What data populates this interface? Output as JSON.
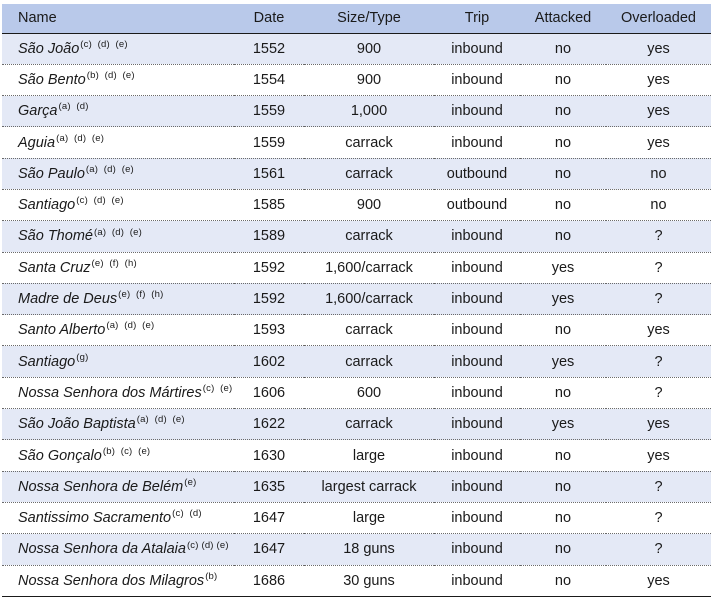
{
  "columns": [
    "Name",
    "Date",
    "Size/Type",
    "Trip",
    "Attacked",
    "Overloaded"
  ],
  "rows": [
    {
      "name": "São João",
      "notes": "(c)  (d)  (e)",
      "date": "1552",
      "size": "900",
      "trip": "inbound",
      "attacked": "no",
      "overloaded": "yes"
    },
    {
      "name": "São Bento",
      "notes": "(b)  (d)  (e)",
      "date": "1554",
      "size": "900",
      "trip": "inbound",
      "attacked": "no",
      "overloaded": "yes"
    },
    {
      "name": "Garça",
      "notes": "(a)  (d)",
      "date": "1559",
      "size": "1,000",
      "trip": "inbound",
      "attacked": "no",
      "overloaded": "yes"
    },
    {
      "name": "Aguia",
      "notes": "(a)  (d)  (e)",
      "date": "1559",
      "size": "carrack",
      "trip": "inbound",
      "attacked": "no",
      "overloaded": "yes"
    },
    {
      "name": "São Paulo",
      "notes": "(a)  (d)  (e)",
      "date": "1561",
      "size": "carrack",
      "trip": "outbound",
      "attacked": "no",
      "overloaded": "no"
    },
    {
      "name": "Santiago",
      "notes": "(c)  (d)  (e)",
      "date": "1585",
      "size": "900",
      "trip": "outbound",
      "attacked": "no",
      "overloaded": "no"
    },
    {
      "name": "São Thomé",
      "notes": "(a)  (d)  (e)",
      "date": "1589",
      "size": "carrack",
      "trip": "inbound",
      "attacked": "no",
      "overloaded": "?"
    },
    {
      "name": "Santa Cruz",
      "notes": "(e)  (f)  (h)",
      "date": "1592",
      "size": "1,600/carrack",
      "trip": "inbound",
      "attacked": "yes",
      "overloaded": "?"
    },
    {
      "name": "Madre de Deus",
      "notes": "(e)  (f)  (h)",
      "date": "1592",
      "size": "1,600/carrack",
      "trip": "inbound",
      "attacked": "yes",
      "overloaded": "?"
    },
    {
      "name": "Santo Alberto",
      "notes": "(a)  (d)  (e)",
      "date": "1593",
      "size": "carrack",
      "trip": "inbound",
      "attacked": "no",
      "overloaded": "yes"
    },
    {
      "name": "Santiago",
      "notes": "(g)",
      "date": "1602",
      "size": "carrack",
      "trip": "inbound",
      "attacked": "yes",
      "overloaded": "?"
    },
    {
      "name": "Nossa Senhora dos Mártires",
      "notes": "(c)  (e)",
      "date": "1606",
      "size": "600",
      "trip": "inbound",
      "attacked": "no",
      "overloaded": "?"
    },
    {
      "name": "São João Baptista",
      "notes": "(a)  (d)  (e)",
      "date": "1622",
      "size": "carrack",
      "trip": "inbound",
      "attacked": "yes",
      "overloaded": "yes"
    },
    {
      "name": "São Gonçalo",
      "notes": "(b)  (c)  (e)",
      "date": "1630",
      "size": "large",
      "trip": "inbound",
      "attacked": "no",
      "overloaded": "yes"
    },
    {
      "name": "Nossa Senhora de Belém",
      "notes": "(e)",
      "date": "1635",
      "size": "largest carrack",
      "trip": "inbound",
      "attacked": "no",
      "overloaded": "?"
    },
    {
      "name": "Santissimo Sacramento",
      "notes": "(c)  (d)",
      "date": "1647",
      "size": "large",
      "trip": "inbound",
      "attacked": "no",
      "overloaded": "?"
    },
    {
      "name": "Nossa Senhora da Atalaia",
      "notes": "(c) (d) (e)",
      "date": "1647",
      "size": "18 guns",
      "trip": "inbound",
      "attacked": "no",
      "overloaded": "?"
    },
    {
      "name": "Nossa Senhora dos Milagros",
      "notes": "(b)",
      "date": "1686",
      "size": "30 guns",
      "trip": "inbound",
      "attacked": "no",
      "overloaded": "yes"
    }
  ]
}
